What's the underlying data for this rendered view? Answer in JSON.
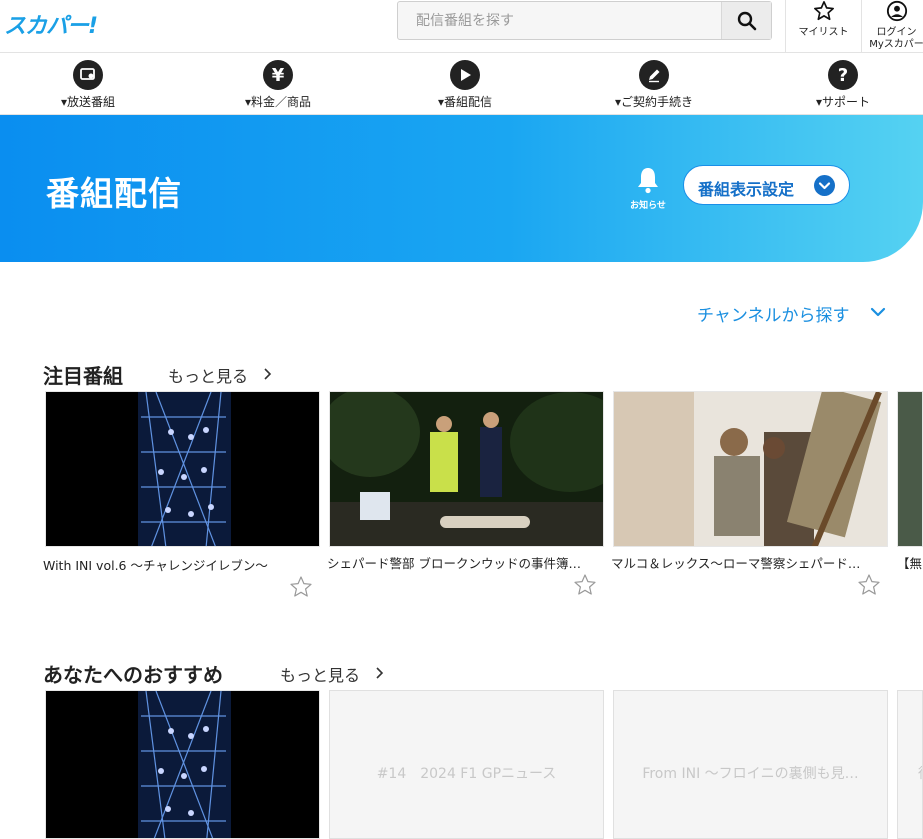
{
  "header": {
    "logo": "スカパー!",
    "search_placeholder": "配信番組を探す",
    "mylist_label": "マイリスト",
    "login_line1": "ログイン",
    "login_line2": "Myスカパー"
  },
  "nav": {
    "items": [
      {
        "label": "▾放送番組"
      },
      {
        "label": "▾料金／商品"
      },
      {
        "label": "▾番組配信"
      },
      {
        "label": "▾ご契約手続き"
      },
      {
        "label": "▾サポート"
      }
    ]
  },
  "hero": {
    "title": "番組配信",
    "notice_label": "お知らせ",
    "display_setting_label": "番組表示設定"
  },
  "channel_search": {
    "label": "チャンネルから探す"
  },
  "featured": {
    "title": "注目番組",
    "more": "もっと見る",
    "cards": [
      {
        "title": "With INI vol.6 〜チャレンジイレブン〜"
      },
      {
        "title": "シェパード警部 ブロークンウッドの事件簿…"
      },
      {
        "title": "マルコ＆レックス〜ローマ警察シェパード…"
      },
      {
        "title": "【無"
      }
    ]
  },
  "recommend": {
    "title": "あなたへのおすすめ",
    "more": "もっと見る",
    "cards": [
      {
        "title": ""
      },
      {
        "title": "#14　2024 F1 GPニュース"
      },
      {
        "title": "From INI 〜フロイニの裏側も見…"
      },
      {
        "title": "徳"
      }
    ]
  },
  "colors": {
    "accent": "#1a8fe0",
    "hero_start": "#0a8ef0",
    "hero_end": "#55d2f2"
  }
}
